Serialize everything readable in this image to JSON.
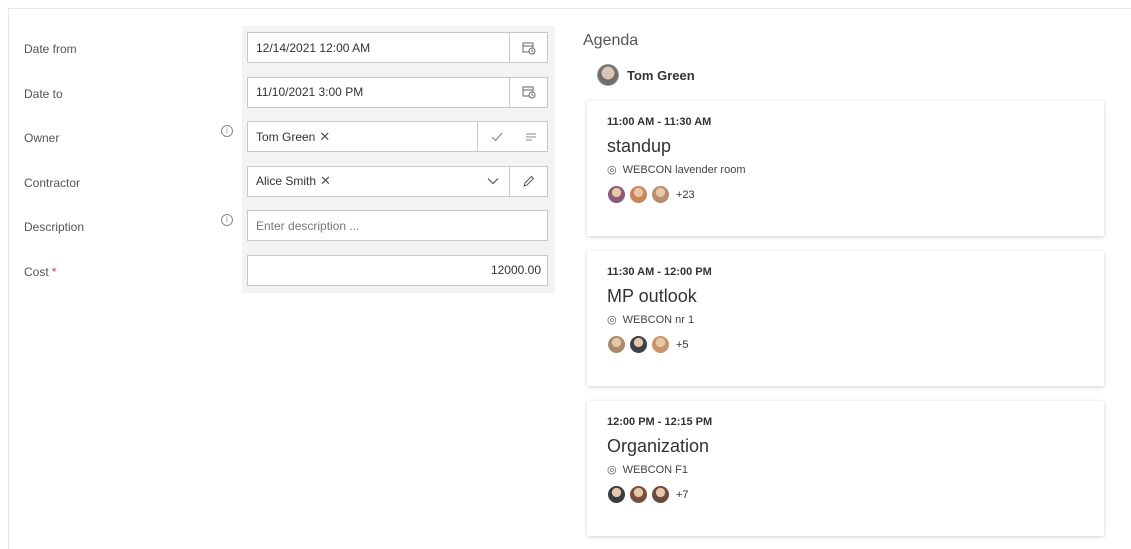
{
  "form": {
    "date_from": {
      "label": "Date from",
      "value": "12/14/2021 12:00 AM",
      "icon": "calendar-clock-icon"
    },
    "date_to": {
      "label": "Date to",
      "value": "11/10/2021 3:00 PM",
      "icon": "calendar-clock-icon"
    },
    "owner": {
      "label": "Owner",
      "value": "Tom Green",
      "remove": "✕",
      "confirm_icon": "checkmark-icon",
      "list_icon": "list-icon",
      "info": "i"
    },
    "contractor": {
      "label": "Contractor",
      "value": "Alice Smith",
      "remove": "✕",
      "dropdown_icon": "chevron-down-icon",
      "edit_icon": "pencil-icon"
    },
    "description": {
      "label": "Description",
      "placeholder": "Enter description ...",
      "info": "i"
    },
    "cost": {
      "label": "Cost",
      "required_mark": "*",
      "value": "12000.00"
    }
  },
  "agenda": {
    "title": "Agenda",
    "owner_name": "Tom Green",
    "events": [
      {
        "time": "11:00 AM - 11:30 AM",
        "title": "standup",
        "location": "WEBCON lavender room",
        "more": "+23",
        "avatars": [
          "#8a5a78",
          "#c9845a",
          "#b98e6e"
        ]
      },
      {
        "time": "11:30 AM - 12:00 PM",
        "title": "MP outlook",
        "location": "WEBCON nr 1",
        "more": "+5",
        "avatars": [
          "#a88c6a",
          "#3e4147",
          "#c9946a"
        ]
      },
      {
        "time": "12:00 PM - 12:15 PM",
        "title": "Organization",
        "location": "WEBCON F1",
        "more": "+7",
        "avatars": [
          "#3a3d44",
          "#7a4e3c",
          "#6b4b3d"
        ]
      }
    ]
  }
}
